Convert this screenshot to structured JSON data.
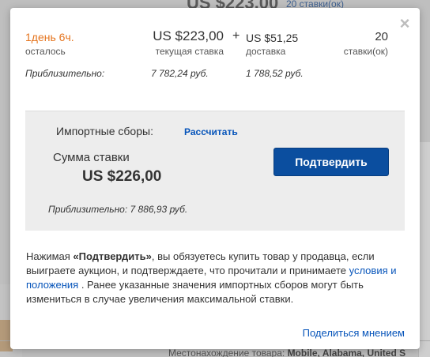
{
  "background": {
    "top_price": "US $223,00",
    "top_link": "20 ставки(ок)",
    "bottom_label": "Местонахождение товара:",
    "bottom_value": "Mobile, Alabama, United S"
  },
  "modal": {
    "close_symbol": "×",
    "time_left": {
      "value": "1день 6ч.",
      "label": "осталось"
    },
    "current_bid": {
      "value": "US $223,00",
      "label": "текущая ставка"
    },
    "plus_sign": "+",
    "shipping": {
      "value": "US $51,25",
      "label": "доставка"
    },
    "bid_count": {
      "value": "20",
      "label": "ставки(ок)"
    },
    "approx": {
      "label": "Приблизительно:",
      "bid": "7 782,24 руб.",
      "shipping": "1 788,52 руб."
    },
    "panel": {
      "import_label": "Импортные сборы:",
      "import_link": "Рассчитать",
      "sum_label": "Сумма ставки",
      "sum_value": "US $226,00",
      "confirm_button": "Подтвердить",
      "approx_text": "Приблизительно:  7 886,93 руб."
    },
    "note": {
      "part1": "Нажимая ",
      "bold": "«Подтвердить»",
      "part2": ", вы обязуетесь купить товар у продавца, если выиграете аукцион, и подтверждаете, что прочитали и принимаете ",
      "link": "условия и положения",
      "part3": " . Ранее указанные значения импортных сборов могут быть измениться в случае увеличения максимальной ставки."
    },
    "feedback_link": "Поделиться мнением"
  },
  "colors": {
    "accent_orange": "#e5751f",
    "link_blue": "#0654ba",
    "button_blue": "#0b4e9f"
  }
}
